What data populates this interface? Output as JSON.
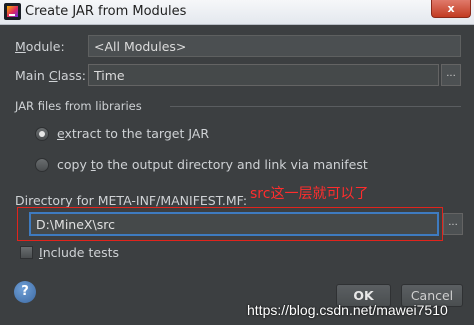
{
  "window": {
    "title": "Create JAR from Modules",
    "close_label": "x"
  },
  "form": {
    "module_label": "Module:",
    "module_value": "<All Modules>",
    "main_class_label": "Main Class:",
    "main_class_value": "Time",
    "browse_label": "..."
  },
  "jar_files": {
    "section_label": "JAR files from libraries",
    "options": [
      {
        "label": "extract to the target JAR",
        "checked": true
      },
      {
        "label": "copy to the output directory and link via manifest",
        "checked": false
      }
    ]
  },
  "manifest": {
    "directory_label": "Directory for META-INF/MANIFEST.MF:",
    "directory_value": "D:\\MineX\\src",
    "annotation": "src这一层就可以了",
    "browse_label": "..."
  },
  "include_tests": {
    "label": "Include tests",
    "checked": false
  },
  "footer": {
    "help_label": "?",
    "ok_label": "OK",
    "cancel_label": "Cancel",
    "watermark": "https://blog.csdn.net/mawei7510"
  },
  "colors": {
    "background": "#3c3f41",
    "annotation_red": "#ff2d2d",
    "focus_blue": "#3e7bc0"
  }
}
